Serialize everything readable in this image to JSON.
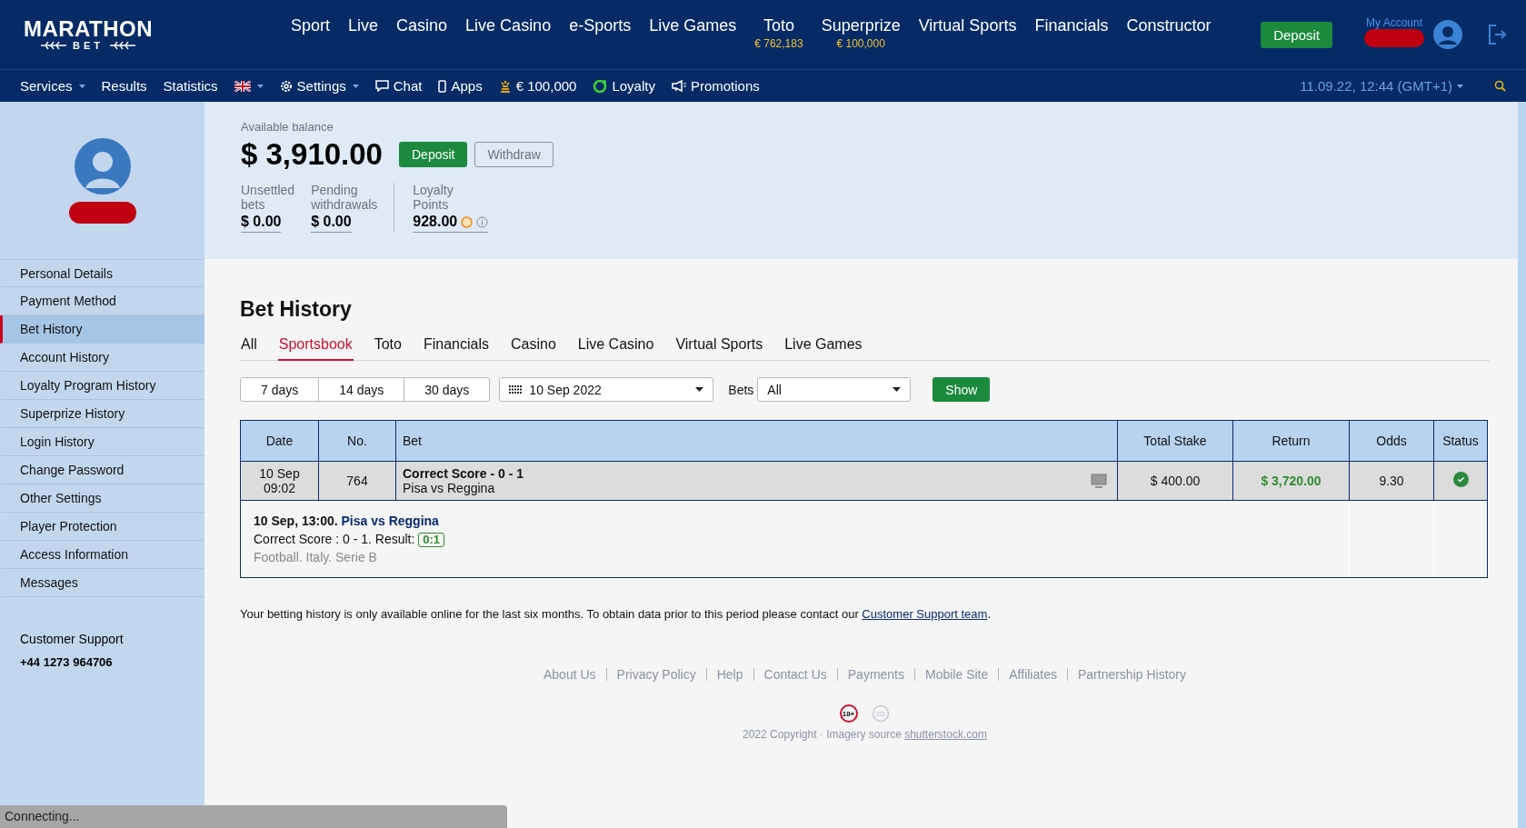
{
  "header": {
    "logo": {
      "name": "MARATHON",
      "sub": "BET"
    },
    "nav": [
      {
        "label": "Sport"
      },
      {
        "label": "Live"
      },
      {
        "label": "Casino"
      },
      {
        "label": "Live Casino"
      },
      {
        "label": "e-Sports"
      },
      {
        "label": "Live Games"
      },
      {
        "label": "Toto",
        "sub": "€ 762,183"
      },
      {
        "label": "Superprize",
        "sub": "€ 100,000"
      },
      {
        "label": "Virtual Sports"
      },
      {
        "label": "Financials"
      },
      {
        "label": "Constructor"
      }
    ],
    "deposit": "Deposit",
    "account_label": "My Account"
  },
  "subnav": {
    "items": [
      {
        "kind": "dropdown",
        "label": "Services"
      },
      {
        "kind": "plain",
        "label": "Results"
      },
      {
        "kind": "plain",
        "label": "Statistics"
      },
      {
        "kind": "flag"
      },
      {
        "kind": "settings",
        "label": "Settings"
      },
      {
        "kind": "chat",
        "label": "Chat"
      },
      {
        "kind": "apps",
        "label": "Apps"
      },
      {
        "kind": "jackpot",
        "label": "€ 100,000"
      },
      {
        "kind": "loyalty",
        "label": "Loyalty"
      },
      {
        "kind": "promo",
        "label": "Promotions"
      }
    ],
    "datetime": "11.09.22, 12:44 (GMT+1)"
  },
  "profile": {
    "balance_label": "Available balance",
    "balance": "$ 3,910.00",
    "deposit": "Deposit",
    "withdraw": "Withdraw",
    "stats": [
      {
        "kind": "money",
        "label": "Unsettled bets",
        "value": "$ 0.00"
      },
      {
        "kind": "money",
        "label": "Pending withdrawals",
        "value": "$ 0.00"
      },
      {
        "kind": "points",
        "label": "Loyalty Points",
        "value": "928.00"
      }
    ]
  },
  "sidebar": {
    "items": [
      {
        "label": "Personal Details",
        "selected": false
      },
      {
        "label": "Payment Method",
        "selected": false
      },
      {
        "label": "Bet History",
        "selected": true
      },
      {
        "label": "Account History",
        "selected": false
      },
      {
        "label": "Loyalty Program History",
        "selected": false
      },
      {
        "label": "Superprize History",
        "selected": false
      },
      {
        "label": "Login History",
        "selected": false
      },
      {
        "label": "Change Password",
        "selected": false
      },
      {
        "label": "Other Settings",
        "selected": false
      },
      {
        "label": "Player Protection",
        "selected": false
      },
      {
        "label": "Access Information",
        "selected": false
      },
      {
        "label": "Messages",
        "selected": false
      }
    ],
    "support_label": "Customer Support",
    "support_phone": "+44 1273 964706"
  },
  "bet_history": {
    "title": "Bet History",
    "tabs": [
      {
        "label": "All",
        "selected": false
      },
      {
        "label": "Sportsbook",
        "selected": true
      },
      {
        "label": "Toto",
        "selected": false
      },
      {
        "label": "Financials",
        "selected": false
      },
      {
        "label": "Casino",
        "selected": false
      },
      {
        "label": "Live Casino",
        "selected": false
      },
      {
        "label": "Virtual Sports",
        "selected": false
      },
      {
        "label": "Live Games",
        "selected": false
      }
    ],
    "periods": [
      "7 days",
      "14 days",
      "30 days"
    ],
    "date": "10 Sep 2022",
    "bets_label": "Bets",
    "bets_value": "All",
    "show": "Show",
    "table": {
      "columns": [
        "Date",
        "No.",
        "Bet",
        "Total Stake",
        "Return",
        "Odds",
        "Status"
      ],
      "rows": [
        {
          "date": "10 Sep",
          "time": "09:02",
          "number": "764",
          "bet": "Correct Score - 0 - 1",
          "match": "Pisa vs Reggina",
          "stake": "$ 400.00",
          "return": "$ 3,720.00",
          "odds": "9.30",
          "kind": "won",
          "detail": {
            "when": "10 Sep, 13:00.",
            "event": "Pisa vs Reggina",
            "selection": "Correct Score : 0 - 1. Result:",
            "result": "0:1",
            "league": "Football. Italy. Serie B"
          }
        }
      ]
    }
  },
  "note": {
    "text": "Your betting history is only available online for the last six months. To obtain data prior to this period please contact our",
    "link": "Customer Support team",
    "end": "."
  },
  "footer": {
    "links": [
      "About Us",
      "Privacy Policy",
      "Help",
      "Contact Us",
      "Payments",
      "Mobile Site",
      "Affiliates",
      "Partnership History"
    ],
    "age": "18+",
    "copyright": "2022 Copyright · Imagery source",
    "source_link": "shutterstock.com"
  },
  "status_bar": "Connecting..."
}
